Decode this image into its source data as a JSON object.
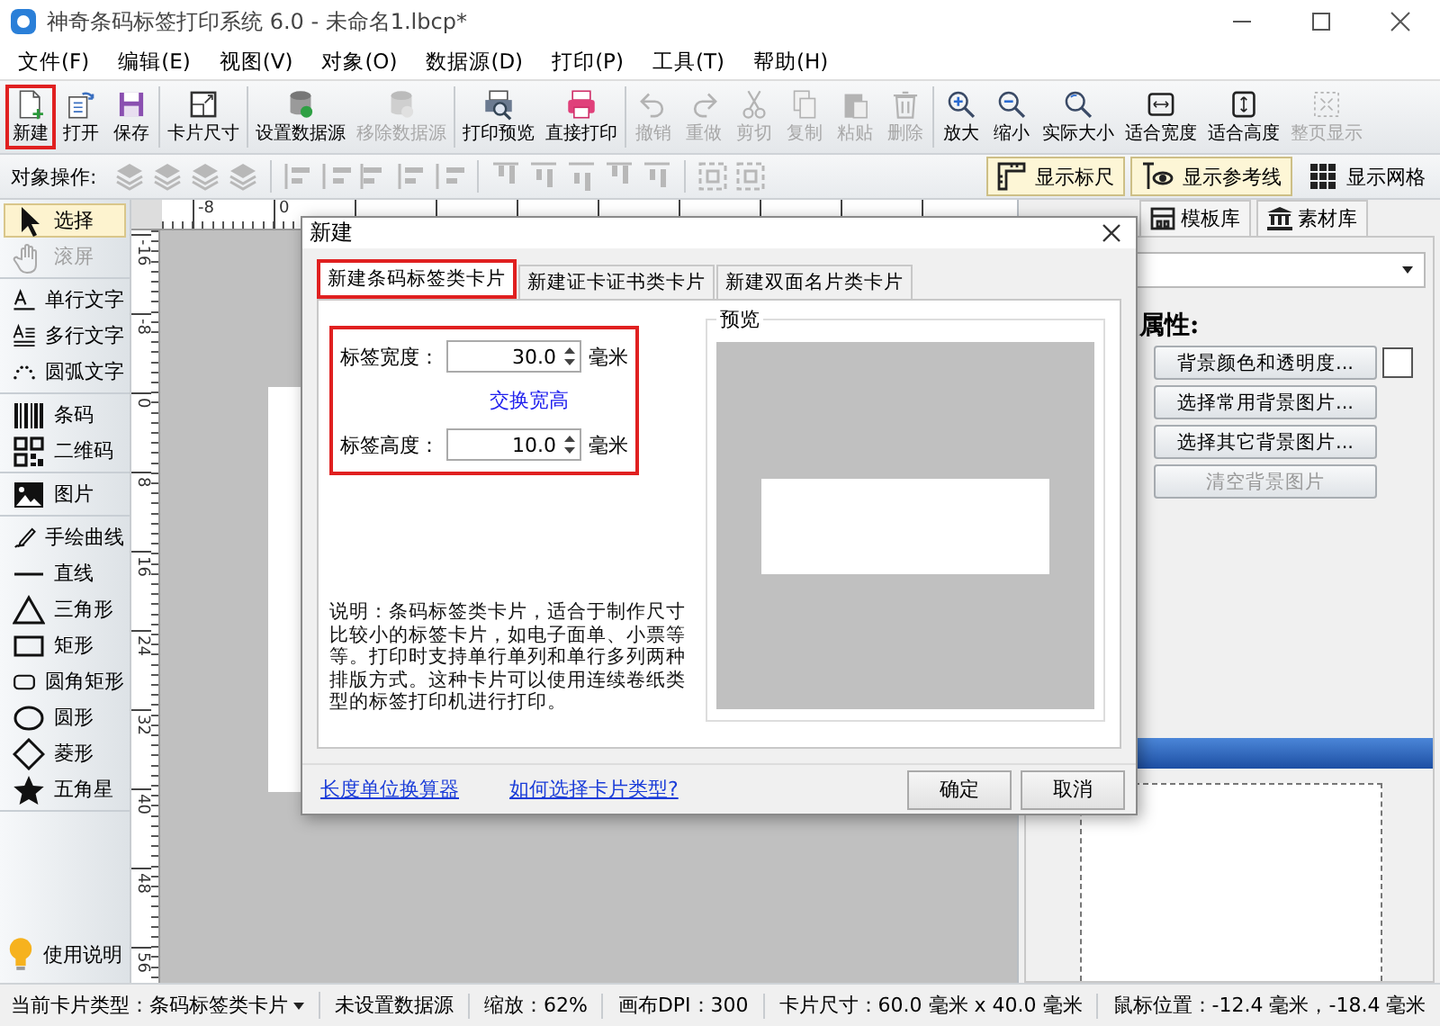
{
  "window": {
    "title": "神奇条码标签打印系统 6.0 - 未命名1.lbcp*"
  },
  "menu": [
    "文件(F)",
    "编辑(E)",
    "视图(V)",
    "对象(O)",
    "数据源(D)",
    "打印(P)",
    "工具(T)",
    "帮助(H)"
  ],
  "toolbar": {
    "groups": [
      [
        {
          "label": "新建",
          "disabled": false,
          "highlighted": true
        },
        {
          "label": "打开",
          "disabled": false,
          "highlighted": false
        },
        {
          "label": "保存",
          "disabled": false,
          "highlighted": false
        }
      ],
      [
        {
          "label": "卡片尺寸",
          "disabled": false,
          "highlighted": false
        }
      ],
      [
        {
          "label": "设置数据源",
          "disabled": false,
          "highlighted": false
        },
        {
          "label": "移除数据源",
          "disabled": true,
          "highlighted": false
        }
      ],
      [
        {
          "label": "打印预览",
          "disabled": false,
          "highlighted": false
        },
        {
          "label": "直接打印",
          "disabled": false,
          "highlighted": false
        }
      ],
      [
        {
          "label": "撤销",
          "disabled": true,
          "highlighted": false
        },
        {
          "label": "重做",
          "disabled": true,
          "highlighted": false
        },
        {
          "label": "剪切",
          "disabled": true,
          "highlighted": false
        },
        {
          "label": "复制",
          "disabled": true,
          "highlighted": false
        },
        {
          "label": "粘贴",
          "disabled": true,
          "highlighted": false
        },
        {
          "label": "删除",
          "disabled": true,
          "highlighted": false
        }
      ],
      [
        {
          "label": "放大",
          "disabled": false,
          "highlighted": false
        },
        {
          "label": "缩小",
          "disabled": false,
          "highlighted": false
        },
        {
          "label": "实际大小",
          "disabled": false,
          "highlighted": false
        },
        {
          "label": "适合宽度",
          "disabled": false,
          "highlighted": false
        },
        {
          "label": "适合高度",
          "disabled": false,
          "highlighted": false
        },
        {
          "label": "整页显示",
          "disabled": true,
          "highlighted": false
        }
      ]
    ]
  },
  "object_bar": {
    "label": "对象操作:",
    "toggles": [
      {
        "label": "显示标尺",
        "on": true
      },
      {
        "label": "显示参考线",
        "on": true
      },
      {
        "label": "显示网格",
        "on": false
      }
    ]
  },
  "tools": {
    "groups": [
      [
        {
          "label": "选择",
          "selected": true,
          "disabled": false
        },
        {
          "label": "滚屏",
          "selected": false,
          "disabled": true
        }
      ],
      [
        {
          "label": "单行文字",
          "selected": false,
          "disabled": false
        },
        {
          "label": "多行文字",
          "selected": false,
          "disabled": false
        },
        {
          "label": "圆弧文字",
          "selected": false,
          "disabled": false
        }
      ],
      [
        {
          "label": "条码",
          "selected": false,
          "disabled": false
        },
        {
          "label": "二维码",
          "selected": false,
          "disabled": false
        }
      ],
      [
        {
          "label": "图片",
          "selected": false,
          "disabled": false
        }
      ],
      [
        {
          "label": "手绘曲线",
          "selected": false,
          "disabled": false
        },
        {
          "label": "直线",
          "selected": false,
          "disabled": false
        },
        {
          "label": "三角形",
          "selected": false,
          "disabled": false
        },
        {
          "label": "矩形",
          "selected": false,
          "disabled": false
        },
        {
          "label": "圆角矩形",
          "selected": false,
          "disabled": false
        },
        {
          "label": "圆形",
          "selected": false,
          "disabled": false
        },
        {
          "label": "菱形",
          "selected": false,
          "disabled": false
        },
        {
          "label": "五角星",
          "selected": false,
          "disabled": false
        }
      ]
    ],
    "help": "使用说明"
  },
  "rulers": {
    "horizontal": [
      "-8",
      "0"
    ],
    "vertical": [
      "-16",
      "-8",
      "0",
      "8",
      "16",
      "24",
      "32",
      "40",
      "48",
      "56"
    ]
  },
  "right_panel": {
    "tabs": [
      "模板库",
      "素材库"
    ],
    "heading": "属性:",
    "buttons": [
      {
        "label": "背景颜色和透明度...",
        "disabled": false
      },
      {
        "label": "选择常用背景图片...",
        "disabled": false
      },
      {
        "label": "选择其它背景图片...",
        "disabled": false
      },
      {
        "label": "清空背景图片",
        "disabled": true
      }
    ]
  },
  "dialog": {
    "title": "新建",
    "tabs": [
      {
        "label": "新建条码标签类卡片",
        "selected": true,
        "highlighted": true
      },
      {
        "label": "新建证卡证书类卡片",
        "selected": false,
        "highlighted": false
      },
      {
        "label": "新建双面名片类卡片",
        "selected": false,
        "highlighted": false
      }
    ],
    "fields_highlighted": true,
    "fields": [
      {
        "label": "标签宽度：",
        "value": "30.0",
        "unit": "毫米"
      },
      {
        "label": "标签高度：",
        "value": "10.0",
        "unit": "毫米"
      }
    ],
    "swap_link": "交换宽高",
    "description": "说明：条码标签类卡片，适合于制作尺寸比较小的标签卡片，如电子面单、小票等等。打印时支持单行单列和单行多列两种排版方式。这种卡片可以使用连续卷纸类型的标签打印机进行打印。",
    "preview_title": "预览",
    "links": [
      "长度单位换算器",
      "如何选择卡片类型?"
    ],
    "buttons": [
      "确定",
      "取消"
    ]
  },
  "status_bar": {
    "card_type": "当前卡片类型：条码标签类卡片",
    "items": [
      "未设置数据源",
      "缩放：62%",
      "画布DPI：300",
      "卡片尺寸：60.0 毫米 x 40.0 毫米",
      "鼠标位置：-12.4 毫米，-18.4 毫米"
    ]
  }
}
